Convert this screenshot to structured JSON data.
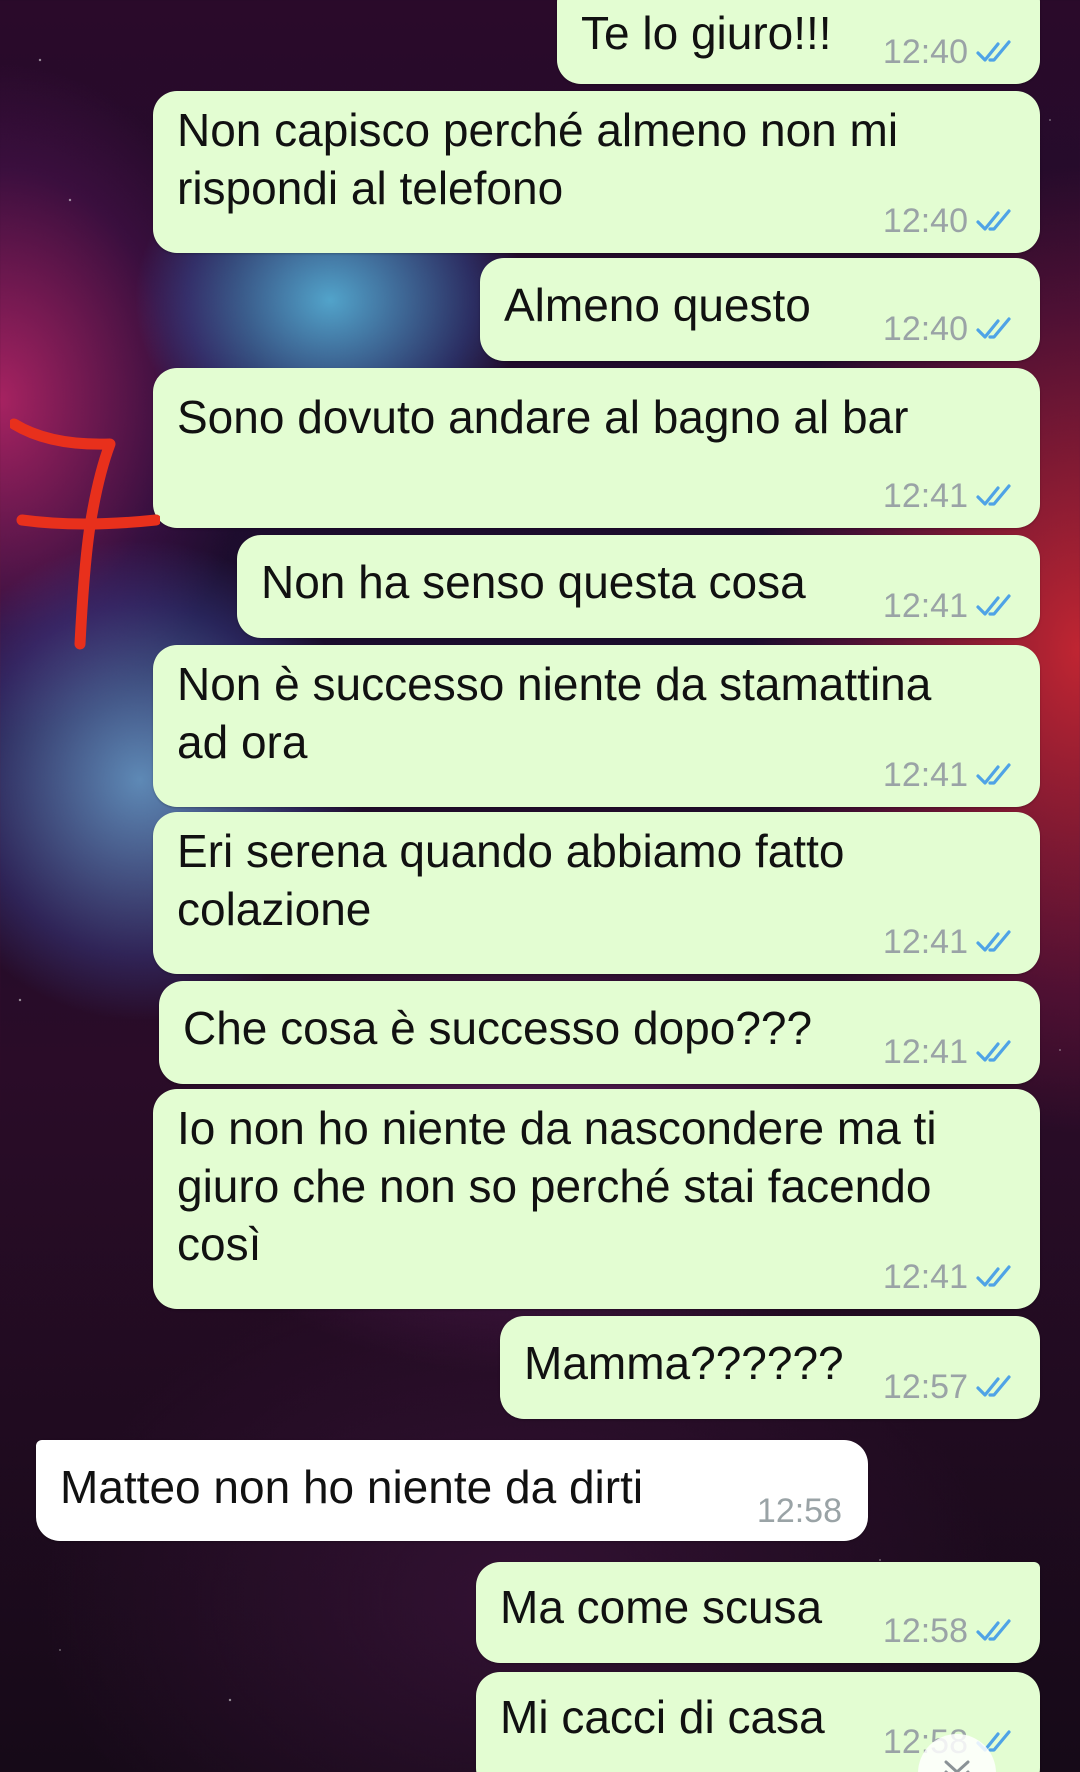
{
  "colors": {
    "outgoing_bubble": "#e3fdd2",
    "incoming_bubble": "#ffffff",
    "read_ticks": "#4fa3e6",
    "timestamp": "#9aa3a6",
    "annotation_marker": "#e8301c"
  },
  "annotation": {
    "mark": "7"
  },
  "icons": {
    "read_receipt": "double-check-icon",
    "scroll_down": "chevron-double-down-icon"
  },
  "messages": [
    {
      "direction": "out",
      "text": "Te lo giuro!!!",
      "time": "12:40",
      "status": "read"
    },
    {
      "direction": "out",
      "text": "Non capisco perché almeno non mi\nrispondi al telefono",
      "time": "12:40",
      "status": "read"
    },
    {
      "direction": "out",
      "text": "Almeno questo",
      "time": "12:40",
      "status": "read"
    },
    {
      "direction": "out",
      "text": "Sono dovuto andare al bagno al bar",
      "time": "12:41",
      "status": "read"
    },
    {
      "direction": "out",
      "text": "Non ha senso questa cosa",
      "time": "12:41",
      "status": "read"
    },
    {
      "direction": "out",
      "text": "Non è successo niente da stamattina\nad ora",
      "time": "12:41",
      "status": "read"
    },
    {
      "direction": "out",
      "text": "Eri serena quando abbiamo fatto\ncolazione",
      "time": "12:41",
      "status": "read"
    },
    {
      "direction": "out",
      "text": "Che cosa è successo dopo???",
      "time": "12:41",
      "status": "read"
    },
    {
      "direction": "out",
      "text": "Io non ho niente da nascondere ma ti\ngiuro che non so perché stai facendo\ncosì",
      "time": "12:41",
      "status": "read"
    },
    {
      "direction": "out",
      "text": "Mamma??????",
      "time": "12:57",
      "status": "read"
    },
    {
      "direction": "in",
      "text": "Matteo non ho niente da dirti",
      "time": "12:58"
    },
    {
      "direction": "out",
      "text": "Ma come scusa",
      "time": "12:58",
      "status": "read"
    },
    {
      "direction": "out",
      "text": "Mi cacci di casa",
      "time": "12:58",
      "status": "read"
    }
  ]
}
